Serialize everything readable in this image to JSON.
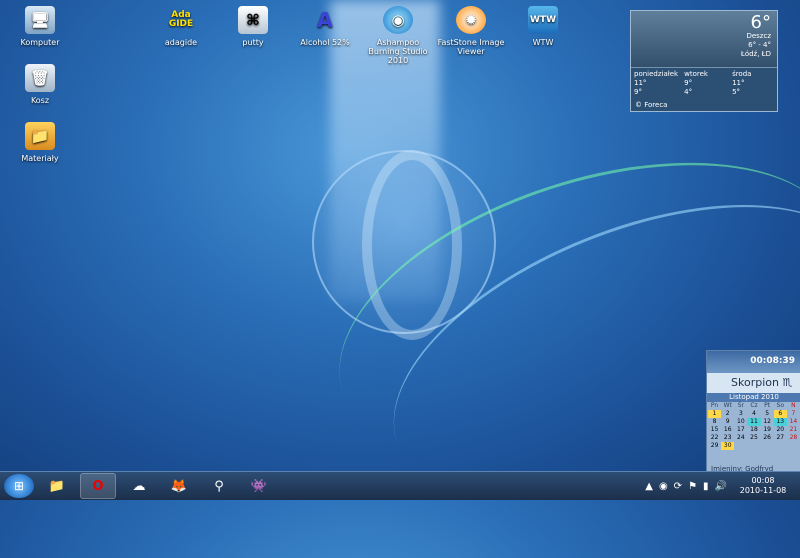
{
  "desktop": {
    "icons": [
      {
        "label": "Komputer"
      },
      {
        "label": "Kosz"
      },
      {
        "label": "Materiały"
      },
      {
        "label": "adagide",
        "glyph": "Ada GIDE"
      },
      {
        "label": "putty"
      },
      {
        "label": "Alcohol 52%",
        "glyph": "A"
      },
      {
        "label": "Ashampoo Burning Studio 2010"
      },
      {
        "label": "FastStone Image Viewer"
      },
      {
        "label": "WTW",
        "glyph": "WTW"
      }
    ]
  },
  "weather": {
    "temp": "6°",
    "condition": "Deszcz",
    "range": "6° - 4°",
    "location": "Łódź, ŁD",
    "days": [
      {
        "name": "poniedziałek",
        "high": "11°",
        "low": "9°"
      },
      {
        "name": "wtorek",
        "high": "9°",
        "low": "4°"
      },
      {
        "name": "środa",
        "high": "11°",
        "low": "5°"
      }
    ],
    "credit": "© Foreca"
  },
  "calendar": {
    "time": "00:08:39",
    "sign": "Skorpion ♏",
    "month": "Listopad 2010",
    "weekdays": [
      "Pn",
      "Wt",
      "Śr",
      "Cz",
      "Pt",
      "So",
      "N"
    ],
    "days": [
      "1",
      "2",
      "3",
      "4",
      "5",
      "6",
      "7",
      "8",
      "9",
      "10",
      "11",
      "12",
      "13",
      "14",
      "15",
      "16",
      "17",
      "18",
      "19",
      "20",
      "21",
      "22",
      "23",
      "24",
      "25",
      "26",
      "27",
      "28",
      "29",
      "30"
    ],
    "namesday": "Imieniny: Godfryd"
  },
  "taskbar": {
    "clock_time": "00:08",
    "clock_date": "2010-11-08"
  },
  "icons": {
    "start": "windows-start-icon",
    "explorer": "folder-icon",
    "opera": "opera-icon",
    "firefox": "firefox-icon"
  }
}
